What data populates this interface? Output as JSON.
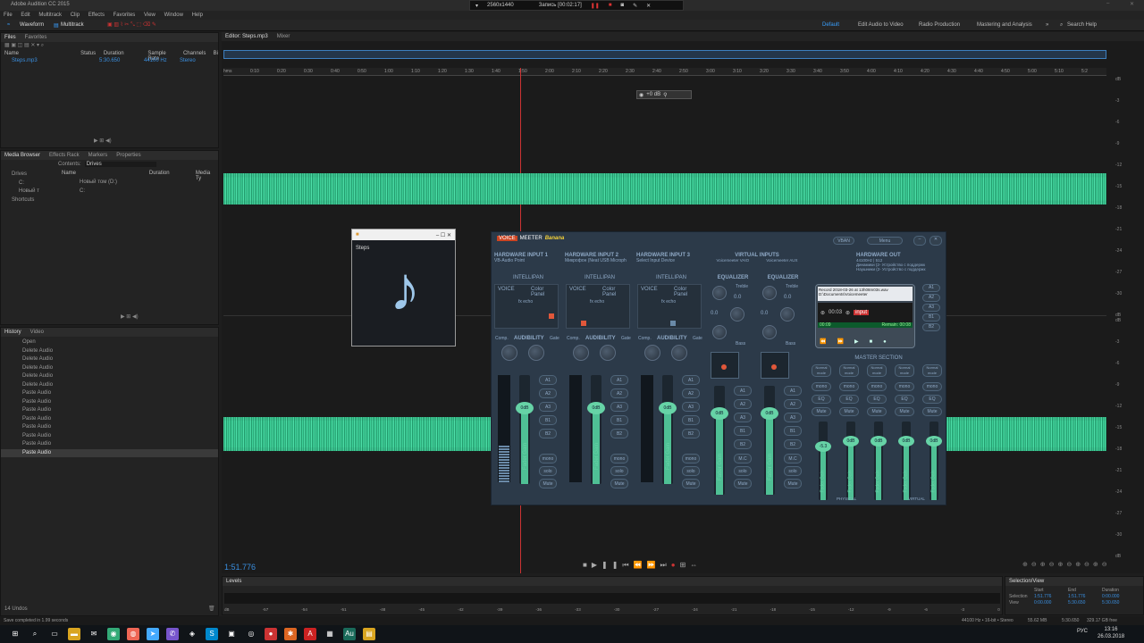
{
  "app": {
    "title": "Adobe Audition CC 2015",
    "menu": [
      "File",
      "Edit",
      "Multitrack",
      "Clip",
      "Effects",
      "Favorites",
      "View",
      "Window",
      "Help"
    ],
    "waveform_tab": "Waveform",
    "multitrack_tab": "Multitrack"
  },
  "recorder": {
    "resolution": "2560x1440",
    "status": "Запись [00:02:17]"
  },
  "workspaces": [
    "Default",
    "Edit Audio to Video",
    "Radio Production",
    "Mastering and Analysis"
  ],
  "search_help": "Search Help",
  "files": {
    "tab": "Files",
    "tab2": "Favorites",
    "cols": [
      "Name",
      "Status",
      "Duration",
      "Sample Rate",
      "Channels",
      "Bi"
    ],
    "row": {
      "name": "Steps.mp3",
      "duration": "5:30.650",
      "rate": "44100 Hz",
      "channels": "Stereo"
    }
  },
  "media": {
    "tabs": [
      "Media Browser",
      "Effects Rack",
      "Markers",
      "Properties"
    ],
    "contents_label": "Contents:",
    "contents_value": "Drives",
    "tree": [
      "Drives",
      "C:",
      "Новый т",
      "Shortcuts"
    ],
    "cols": [
      "Name",
      "Duration",
      "Media Ty"
    ],
    "items": [
      "Новый том (D:)",
      "C:"
    ]
  },
  "history": {
    "tabs": [
      "History",
      "Video"
    ],
    "items": [
      "Open",
      "Delete Audio",
      "Delete Audio",
      "Delete Audio",
      "Delete Audio",
      "Delete Audio",
      "Paste Audio",
      "Paste Audio",
      "Paste Audio",
      "Paste Audio",
      "Paste Audio",
      "Paste Audio",
      "Paste Audio",
      "Paste Audio"
    ],
    "undos": "14 Undos"
  },
  "editor": {
    "tab": "Editor: Steps.mp3",
    "tab2": "Mixer",
    "gain": "+0 dB",
    "time": "1:51.776",
    "ruler": [
      "hms",
      "0:10",
      "0:20",
      "0:30",
      "0:40",
      "0:50",
      "1:00",
      "1:10",
      "1:20",
      "1:30",
      "1:40",
      "1:50",
      "2:00",
      "2:10",
      "2:20",
      "2:30",
      "2:40",
      "2:50",
      "3:00",
      "3:10",
      "3:20",
      "3:30",
      "3:40",
      "3:50",
      "4:00",
      "4:10",
      "4:20",
      "4:30",
      "4:40",
      "4:50",
      "5:00",
      "5:10",
      "5:2"
    ],
    "db_scale": [
      "dB",
      "-3",
      "-6",
      "-9",
      "-12",
      "-15",
      "-18",
      "-21",
      "-24",
      "-27",
      "-30",
      "dB"
    ]
  },
  "steps_window": {
    "title": "Steps"
  },
  "voicemeeter": {
    "logo1": "VOICE",
    "logo2": "MEETER",
    "brand": "Banana",
    "vban": "VBAN",
    "menu": "Menu",
    "hw_inputs": [
      {
        "title": "HARDWARE INPUT 1",
        "dev": "VB-Audio Point"
      },
      {
        "title": "HARDWARE INPUT 2",
        "dev": "Микрофон (Neat USB Microph"
      },
      {
        "title": "HARDWARE INPUT 3",
        "dev": "Select Input Device"
      }
    ],
    "virtual": {
      "title": "VIRTUAL INPUTS",
      "a": "Voicemeeter VAIO",
      "b": "Voicemeeter AUX",
      "rate": "44100 Hz / 4096"
    },
    "intellipan": "INTELLIPAN",
    "voice": "VOICE",
    "color_panel": "Color Panel",
    "fx_echo": "fx echo",
    "audibility": "AUDIBILITY",
    "comp": "Comp.",
    "gate": "Gate",
    "fader_gain": "Fader Gain",
    "odb": "0dB",
    "buses": [
      "A1",
      "A2",
      "A3",
      "B1",
      "B2"
    ],
    "mono": "mono",
    "solo": "solo",
    "mute": "Mute",
    "mc": "M.C",
    "equalizer": "EQUALIZER",
    "treble": "Treble",
    "bass": "Bass",
    "eq_vals": [
      "0.0",
      "0.0"
    ],
    "hw_out": {
      "title": "HARDWARE OUT",
      "rate": "44100Hz | 512",
      "dev1": "Динамики (2- Устройство с поддержк",
      "dev2": "Наушники (2- Устройство с поддержк"
    },
    "tape": {
      "file": "Record 2018-03-26 at 13h08m03s.wav",
      "path": "D:\\Documents\\Voicemeeter",
      "time": "00:03",
      "elapsed": "00:09",
      "remain": "Remain: 00:08",
      "input": "input"
    },
    "master": "MASTER SECTION",
    "normal": "Normal mode",
    "eq": "EQ",
    "odb_master": "-5.3",
    "physical": "PHYSICAL",
    "virtual_lbl": "VIRTUAL"
  },
  "levels": {
    "title": "Levels",
    "scale": [
      "dB",
      "-57",
      "-54",
      "-51",
      "-48",
      "-45",
      "-42",
      "-39",
      "-36",
      "-33",
      "-30",
      "-27",
      "-24",
      "-21",
      "-18",
      "-15",
      "-12",
      "-9",
      "-6",
      "-3",
      "0"
    ]
  },
  "selview": {
    "title": "Selection/View",
    "cols": [
      "Start",
      "End",
      "Duration"
    ],
    "rows": [
      {
        "label": "Selection",
        "start": "1:51.776",
        "end": "1:51.776",
        "dur": "0:00.000"
      },
      {
        "label": "View",
        "start": "0:00.000",
        "end": "5:30.650",
        "dur": "5:30.650"
      }
    ]
  },
  "status": {
    "left": "Save completed in 1.99 seconds",
    "format": "44100 Hz • 16-bit • Stereo",
    "size": "55.62 MB",
    "dur": "5:30.650",
    "free": "329.17 GB free"
  },
  "clock": {
    "time": "13:16",
    "date": "26.03.2018",
    "lang": "РУС"
  }
}
